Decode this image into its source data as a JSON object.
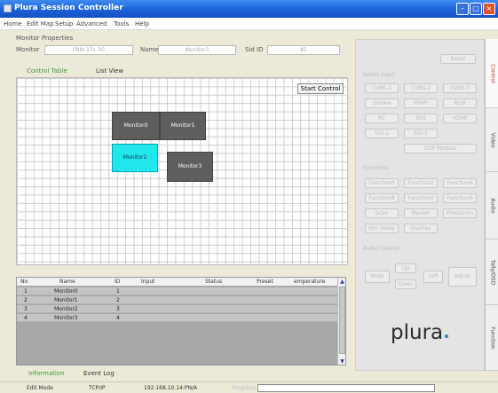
{
  "window": {
    "title": "Plura Session Controller"
  },
  "menu": [
    "Home",
    "Edit Map",
    "Setup",
    "Advanced",
    "Tools",
    "Help"
  ],
  "monitor_properties": {
    "heading": "Monitor Properties",
    "monitor_label": "Monitor",
    "monitor_value": "PRM-17s 3G",
    "name_label": "Name",
    "name_value": "Monitor3",
    "sid_label": "Sid ID",
    "sid_value": "85"
  },
  "view_tabs": [
    "Control Table",
    "List View"
  ],
  "canvas": {
    "start_control": "Start Control",
    "monitors": [
      "Monitor0",
      "Monitor1",
      "Monitor2",
      "Monitor3"
    ]
  },
  "table": {
    "headers": [
      "No",
      "Name",
      "ID",
      "Input",
      "Status",
      "Preset",
      "emperature"
    ],
    "rows": [
      {
        "no": "1",
        "name": "Monitor0",
        "id": "1"
      },
      {
        "no": "2",
        "name": "Monitor1",
        "id": "2"
      },
      {
        "no": "3",
        "name": "Monitor2",
        "id": "3"
      },
      {
        "no": "4",
        "name": "Monitor3",
        "id": "4"
      }
    ]
  },
  "bottom_tabs": [
    "Information",
    "Event Log"
  ],
  "status": {
    "mode": "Edit Mode",
    "protocol": "TCP/IP",
    "address": "192.168.10.14:PN/A",
    "progress_label": "Progress"
  },
  "right_panel": {
    "reset": "Reset",
    "select_input_label": "Select Input",
    "inputs": [
      "CVBS-1",
      "CVBS-2",
      "CVBS-3",
      "SVideo",
      "YPbPr",
      "RGB",
      "PC",
      "DVI",
      "HDMI",
      "SDI-1",
      "SDI-2",
      "DSP Module"
    ],
    "functions_label": "Functions",
    "functions": [
      "Function0",
      "Function2",
      "Function6",
      "Function8",
      "Function0",
      "Function6",
      "Scan",
      "Marker",
      "Pixelzoom",
      "H/V Delay",
      "Overlay"
    ],
    "audio_label": "Audio Control",
    "audio": [
      "Mute",
      "Up",
      "Down",
      "Left",
      "Adjust"
    ]
  },
  "side_tabs": [
    "Control",
    "Video",
    "Audio",
    "Tally/OSD",
    "Function"
  ],
  "logo": "plura"
}
